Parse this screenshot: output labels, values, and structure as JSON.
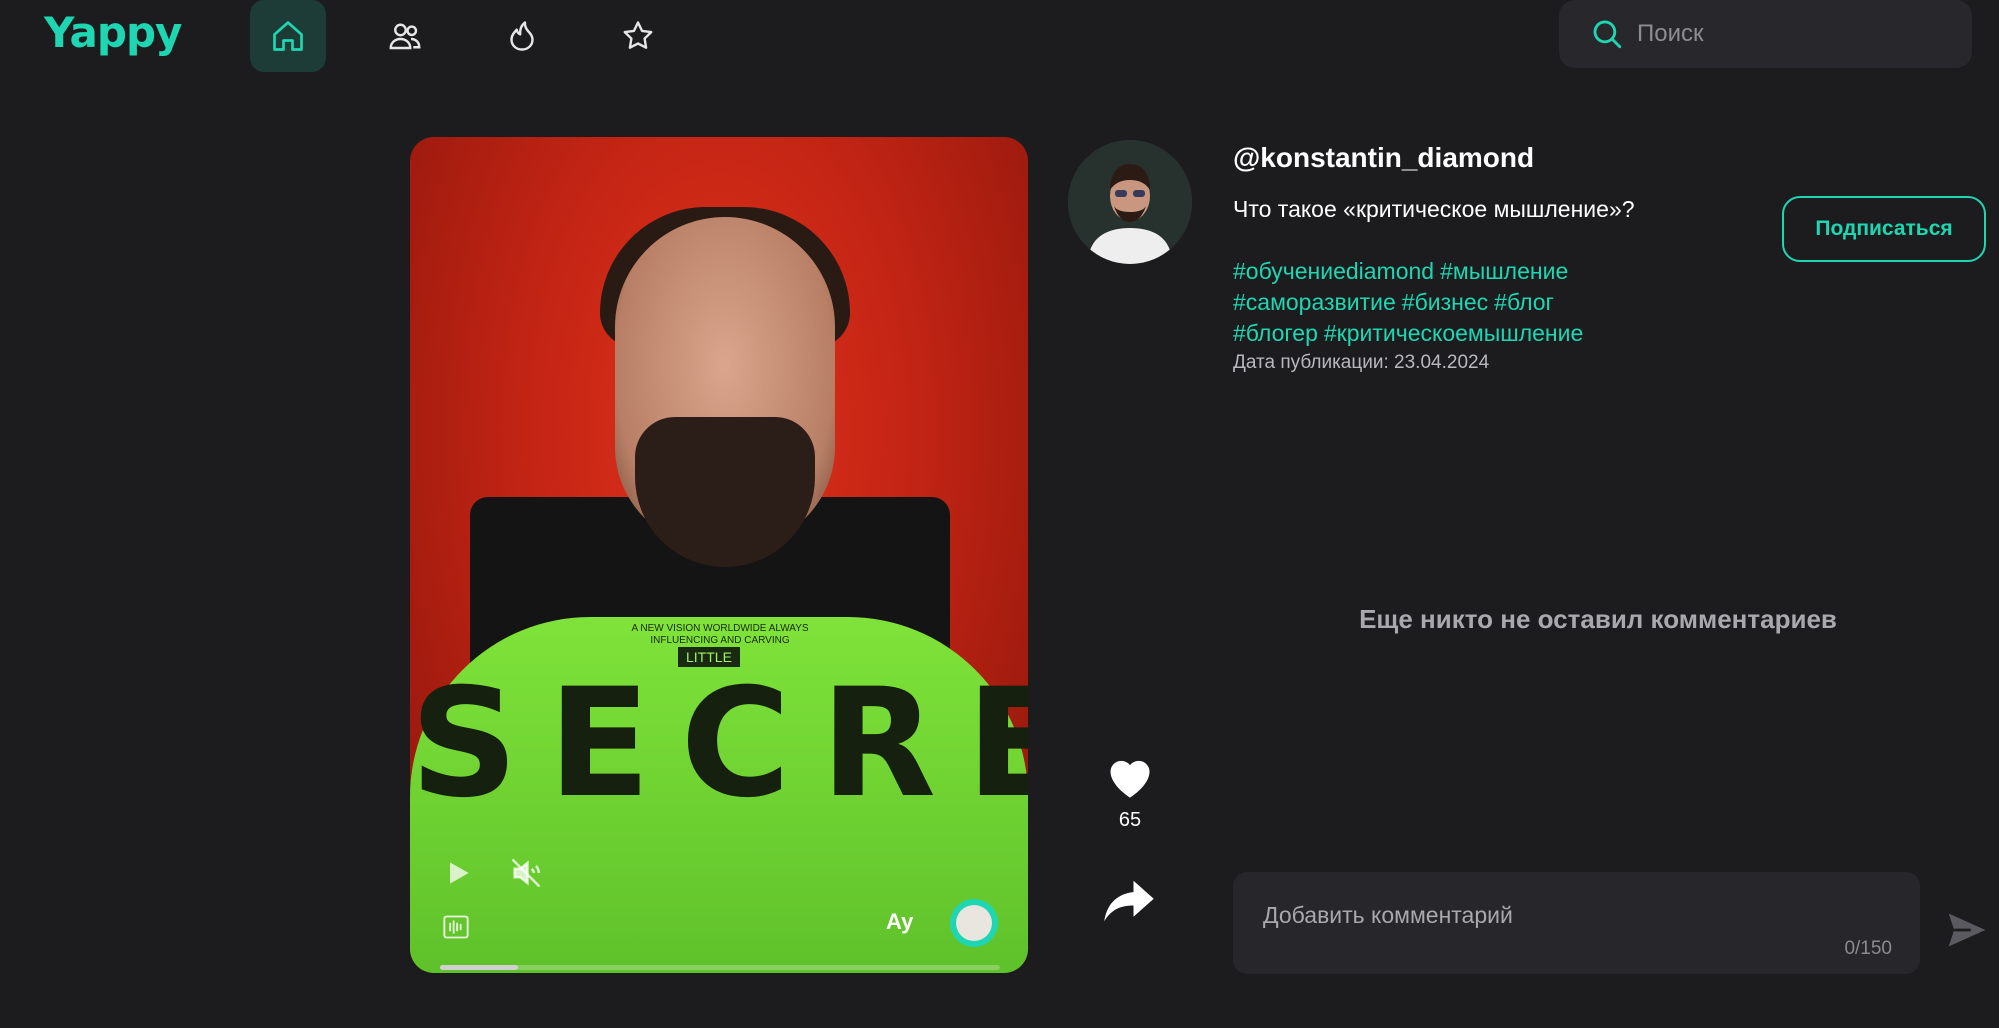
{
  "brand": {
    "logo_text": "Yappy",
    "accent_color": "#1ed6b2"
  },
  "nav": {
    "items": [
      {
        "icon": "home-icon",
        "active": true
      },
      {
        "icon": "people-icon",
        "active": false
      },
      {
        "icon": "flame-icon",
        "active": false
      },
      {
        "icon": "star-icon",
        "active": false
      }
    ]
  },
  "search": {
    "placeholder": "Поиск",
    "icon": "search-icon"
  },
  "video": {
    "shirt_print": "SECRE",
    "shirt_small_text": "A NEW VISION WORLDWIDE ALWAYS INFLUENCING AND CARVING",
    "shirt_badge": "LITTLE",
    "author_overlay": "Ay",
    "progress": 0.14,
    "controls": [
      "play-icon",
      "mute-icon",
      "audio-wave-icon"
    ]
  },
  "post": {
    "username": "@konstantin_diamond",
    "description": "Что такое «критическое мышление»?",
    "hashtags": [
      "#обучениеdiamond",
      "#мышление",
      "#саморазвитие",
      "#бизнес",
      "#блог",
      "#блогер",
      "#критическоемышление"
    ],
    "publish_date": "Дата публикации: 23.04.2024",
    "subscribe_label": "Подписаться"
  },
  "actions": {
    "likes": "65",
    "like_icon": "heart-icon",
    "share_icon": "share-icon"
  },
  "comments": {
    "empty_text": "Еще никто не оставил комментариев",
    "input_placeholder": "Добавить комментарий",
    "counter": "0/150",
    "send_icon": "send-icon"
  }
}
